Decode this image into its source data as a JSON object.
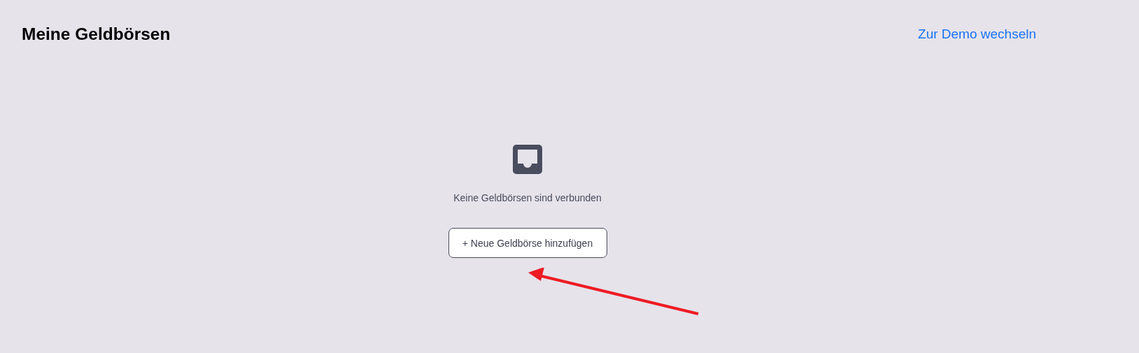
{
  "header": {
    "title": "Meine Geldbörsen",
    "link": "Zur Demo wechseln"
  },
  "empty_state": {
    "message": "Keine Geldbörsen sind verbunden",
    "button": "+ Neue Geldbörse hinzufügen"
  }
}
